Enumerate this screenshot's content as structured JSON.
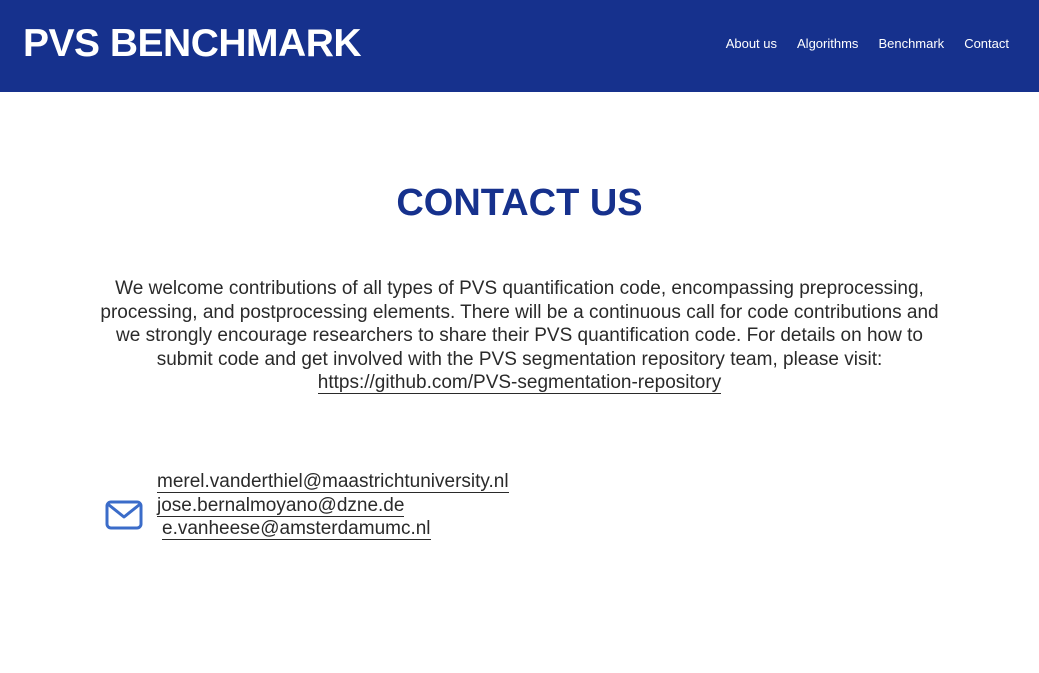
{
  "header": {
    "brand": "PVS BENCHMARK",
    "nav": [
      {
        "label": "About us"
      },
      {
        "label": "Algorithms"
      },
      {
        "label": "Benchmark"
      },
      {
        "label": "Contact"
      }
    ],
    "background_color": "#16318d"
  },
  "main": {
    "title": "CONTACT US",
    "intro_text": "We welcome contributions of all types of PVS quantification code, encompassing preprocessing, processing, and postprocessing elements. There will be a continuous call for code contributions and we strongly encourage researchers to share their PVS quantification code. For details on how to submit code and get involved with the PVS segmentation repository team, please visit: ",
    "repo_link": "https://github.com/PVS-segmentation-repository",
    "title_color": "#16318d"
  },
  "contact": {
    "icon": "mail-icon",
    "icon_color": "#3b6cc9",
    "emails": [
      "merel.vanderthiel@maastrichtuniversity.nl",
      "jose.bernalmoyano@dzne.de",
      "e.vanheese@amsterdamumc.nl"
    ]
  }
}
